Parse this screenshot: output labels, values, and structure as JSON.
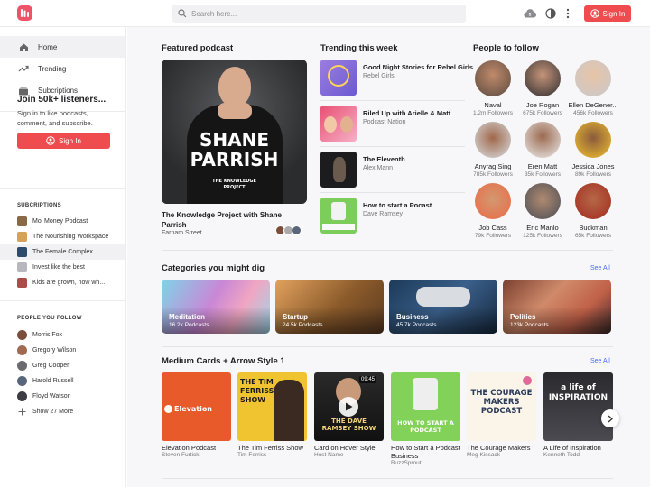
{
  "header": {
    "search_placeholder": "Search here...",
    "signin_label": "Sign In"
  },
  "sidebar": {
    "nav": [
      {
        "label": "Home",
        "icon": "home-icon"
      },
      {
        "label": "Trending",
        "icon": "trending-icon"
      },
      {
        "label": "Subcriptions",
        "icon": "subscriptions-icon"
      }
    ],
    "join_title": "Join 50k+ listeners...",
    "join_desc": "Sign in to like podcasts, comment, and subscribe.",
    "signin_label": "Sign In",
    "subscriptions_label": "SUBCRIPTIONS",
    "subscriptions": [
      "Mo' Money Podcast",
      "The Nourishing Workspace",
      "The Female Complex",
      "Invest like the best",
      "Kids are grown, now wh..."
    ],
    "people_label": "PEOPLE YOU FOLLOW",
    "people": [
      "Morris Fox",
      "Gregory Wilson",
      "Greg Cooper",
      "Harold Russell",
      "Floyd Watson"
    ],
    "show_more": "Show 27 More"
  },
  "featured": {
    "section_title": "Featured podcast",
    "art_name_line1": "SHANE",
    "art_name_line2": "PARRISH",
    "art_brand_line1": "THE KNOWLEDGE",
    "art_brand_line2": "PROJECT",
    "title": "The Knowledge Project with Shane Parrish",
    "subtitle": "Farnam Street"
  },
  "trending": {
    "section_title": "Trending this week",
    "items": [
      {
        "title": "Good Night Stories for Rebel Girls",
        "sub": "Rebel Girls"
      },
      {
        "title": "Riled Up with Arielle & Matt",
        "sub": "Podcast Nation"
      },
      {
        "title": "The Eleventh",
        "sub": "Alex Mann"
      },
      {
        "title": "How to start a Pocast",
        "sub": "Dave Ramsey"
      }
    ]
  },
  "people_to_follow": {
    "section_title": "People to follow",
    "people": [
      {
        "name": "Naval",
        "followers": "1.2m Followers"
      },
      {
        "name": "Joe Rogan",
        "followers": "675k Followers"
      },
      {
        "name": "Ellen DeGener...",
        "followers": "456k Followers"
      },
      {
        "name": "Anyrag Sing",
        "followers": "785k Followers"
      },
      {
        "name": "Eren Matt",
        "followers": "35k Followers"
      },
      {
        "name": "Jessica Jones",
        "followers": "89k Followers"
      },
      {
        "name": "Job Cass",
        "followers": "79k Followers"
      },
      {
        "name": "Eric Manlo",
        "followers": "125k Followers"
      },
      {
        "name": "Buckman",
        "followers": "65k Followers"
      }
    ]
  },
  "categories": {
    "section_title": "Categories you might dig",
    "see_all": "See All",
    "items": [
      {
        "name": "Meditation",
        "count": "16.2k Podcasts"
      },
      {
        "name": "Startup",
        "count": "24.5k Podcasts"
      },
      {
        "name": "Business",
        "count": "45.7k Podcasts"
      },
      {
        "name": "Politics",
        "count": "123k Podcasts"
      }
    ]
  },
  "medium_cards": {
    "section_title": "Medium Cards + Arrow Style 1",
    "see_all": "See All",
    "items": [
      {
        "title": "Elevation Podcast",
        "sub": "Steven Furtick",
        "art": "Elevation"
      },
      {
        "title": "The Tim Ferriss Show",
        "sub": "Tim Ferriss",
        "art": "THE TIM FERRISS SHOW"
      },
      {
        "title": "Card on Hover Style",
        "sub": "Host Name",
        "art": "THE DAVE RAMSEY SHOW",
        "duration": "09:45"
      },
      {
        "title": "How to Start a Podcast Business",
        "sub": "BuzzSprout",
        "art": "HOW TO START A PODCAST"
      },
      {
        "title": "The Courage Makers",
        "sub": "Meg Kissack",
        "art": "THE COURAGE MAKERS PODCAST"
      },
      {
        "title": "A Life of Inspiration",
        "sub": "Kenneth Todd",
        "art": "a life of INSPIRATION"
      }
    ]
  },
  "colors": {
    "accent": "#ee4c4e",
    "link": "#4a6cf7"
  }
}
